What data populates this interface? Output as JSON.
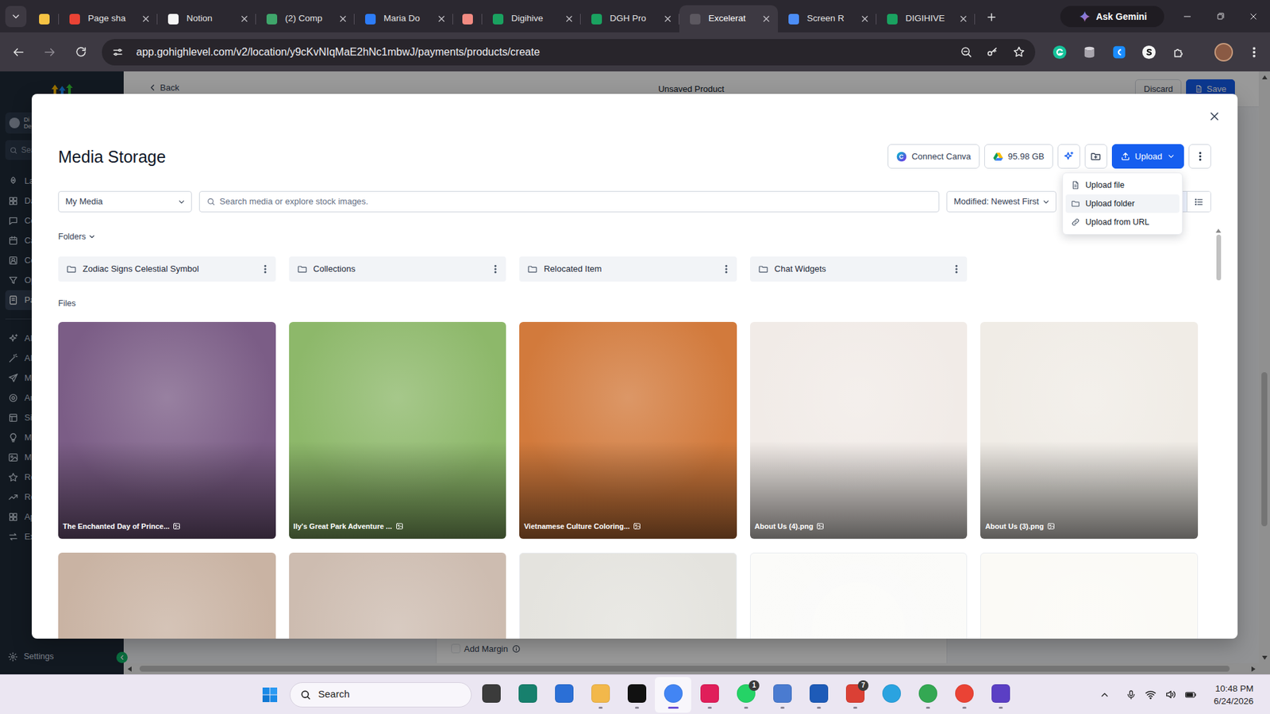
{
  "browser": {
    "tabs": [
      {
        "label": "",
        "selected": false,
        "color": "#f6c343"
      },
      {
        "label": "Page sha",
        "selected": false,
        "color": "#ea4335"
      },
      {
        "label": "Notion",
        "selected": false,
        "color": "#f5f5f5"
      },
      {
        "label": "(2) Comp",
        "selected": false,
        "color": "#3fa66b"
      },
      {
        "label": "Maria Do",
        "selected": false,
        "color": "#2d7cf6"
      },
      {
        "label": "",
        "selected": false,
        "color": "#f28b82"
      },
      {
        "label": "Digihive",
        "selected": false,
        "color": "#1aa260"
      },
      {
        "label": "DGH Pro",
        "selected": false,
        "color": "#1aa260"
      },
      {
        "label": "Excelerat",
        "selected": true,
        "color": "#5c5860"
      },
      {
        "label": "Screen R",
        "selected": false,
        "color": "#4c8df6"
      },
      {
        "label": "DIGIHIVE",
        "selected": false,
        "color": "#1aa260"
      }
    ],
    "gemini": "Ask Gemini",
    "url": "app.gohighlevel.com/v2/location/y9cKvNIqMaE2hNc1mbwJ/payments/products/create"
  },
  "app": {
    "back": "Back",
    "title": "Unsaved Product",
    "discard": "Discard",
    "save": "Save",
    "sidebar": {
      "user": [
        "Di",
        "De"
      ],
      "search": "Sea",
      "items": [
        {
          "label": "La",
          "selected": false
        },
        {
          "label": "Da",
          "selected": false
        },
        {
          "label": "Co",
          "selected": false
        },
        {
          "label": "Ca",
          "selected": false
        },
        {
          "label": "Co",
          "selected": false
        },
        {
          "label": "Op",
          "selected": false
        },
        {
          "label": "Pa",
          "selected": true
        }
      ],
      "tools": [
        {
          "label": "AI",
          "selected": false
        },
        {
          "label": "AI",
          "selected": false
        },
        {
          "label": "M",
          "selected": false
        },
        {
          "label": "Au",
          "selected": false
        },
        {
          "label": "Si",
          "selected": false
        },
        {
          "label": "M",
          "selected": false
        },
        {
          "label": "M",
          "selected": false
        },
        {
          "label": "Re",
          "selected": false
        },
        {
          "label": "Re",
          "selected": false
        },
        {
          "label": "Ap",
          "selected": false
        },
        {
          "label": "Ex",
          "selected": false
        }
      ],
      "settings": "Settings"
    },
    "add_margin": {
      "label": "Add Margin",
      "checked": false
    }
  },
  "media": {
    "title": "Media Storage",
    "connect_canva": "Connect Canva",
    "storage": "95.98 GB",
    "upload": "Upload",
    "upload_menu": [
      {
        "label": "Upload file",
        "kind": "file",
        "selected": false
      },
      {
        "label": "Upload folder",
        "kind": "folder",
        "selected": true
      },
      {
        "label": "Upload from URL",
        "kind": "url",
        "selected": false
      }
    ],
    "source": "My Media",
    "search_placeholder": "Search media or explore stock images.",
    "sort": "Modified: Newest First",
    "view": [
      {
        "kind": "grid",
        "selected": true
      },
      {
        "kind": "list",
        "selected": false
      }
    ],
    "folders_heading": "Folders",
    "folders": [
      {
        "name": "Zodiac Signs Celestial Symbol"
      },
      {
        "name": "Collections"
      },
      {
        "name": "Relocated Item"
      },
      {
        "name": "Chat Widgets"
      }
    ],
    "files_heading": "Files",
    "files": [
      {
        "name": "The Enchanted Day of Prince...",
        "color": "#7b5d86"
      },
      {
        "name": "Ily's Great Park Adventure ...",
        "color": "#8db86a"
      },
      {
        "name": "Vietnamese Culture Coloring...",
        "color": "#d27a3c"
      },
      {
        "name": "About Us (4).png",
        "color": "#f1ebe7"
      },
      {
        "name": "About Us (3).png",
        "color": "#f0ece6"
      }
    ],
    "more_files": [
      {
        "color": "#c9b3a3"
      },
      {
        "color": "#cdbcb0"
      },
      {
        "color": "#e4e3de"
      },
      {
        "color": "#fbfbf9"
      },
      {
        "color": "#fbfaf6"
      }
    ]
  },
  "taskbar": {
    "search": "Search",
    "apps": [
      {
        "kind": "square",
        "color": "#3b3b3b",
        "running": false,
        "selected": false
      },
      {
        "kind": "square",
        "color": "#17806d",
        "running": false,
        "selected": false
      },
      {
        "kind": "square",
        "color": "#2b6fd6",
        "running": false,
        "selected": false
      },
      {
        "kind": "square",
        "color": "#f2b84b",
        "running": true,
        "selected": false
      },
      {
        "kind": "square",
        "color": "#111111",
        "running": true,
        "selected": false
      },
      {
        "kind": "round",
        "color": "#4285f4",
        "running": true,
        "selected": true
      },
      {
        "kind": "square",
        "color": "#e01e5a",
        "running": true,
        "selected": false
      },
      {
        "kind": "round",
        "color": "#25d366",
        "running": true,
        "selected": false,
        "badge": "1"
      },
      {
        "kind": "square",
        "color": "#4a7bd0",
        "running": true,
        "selected": false
      },
      {
        "kind": "square",
        "color": "#1e5bb8",
        "running": true,
        "selected": false
      },
      {
        "kind": "square",
        "color": "#db4035",
        "running": true,
        "selected": false,
        "badge": "7"
      },
      {
        "kind": "round",
        "color": "#2aa3e0",
        "running": false,
        "selected": false
      },
      {
        "kind": "round",
        "color": "#34a853",
        "running": true,
        "selected": false
      },
      {
        "kind": "round",
        "color": "#ea4335",
        "running": true,
        "selected": false
      },
      {
        "kind": "square",
        "color": "#5b3fc4",
        "running": true,
        "selected": false
      }
    ],
    "time": "10:48 PM",
    "date": "6/24/2026"
  }
}
